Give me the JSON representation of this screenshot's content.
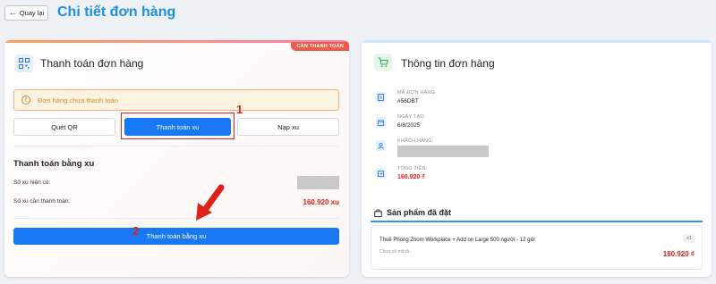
{
  "header": {
    "back_label": "Quay lại",
    "title": "Chi tiết đơn hàng"
  },
  "payment": {
    "badge": "CẦN THANH TOÁN",
    "title": "Thanh toán đơn hàng",
    "alert": "Đơn hàng chưa thanh toán",
    "tabs": [
      {
        "label": "Quét QR",
        "active": false
      },
      {
        "label": "Thanh toán xu",
        "active": true
      },
      {
        "label": "Nạp xu",
        "active": false
      }
    ],
    "section_title": "Thanh toán bằng xu",
    "balance_label": "Số xu hiện có:",
    "required_label": "Số xu cần thanh toán:",
    "required_value": "160.920 xu",
    "pay_button": "Thanh toán bằng xu"
  },
  "annotations": {
    "marker_1": "1",
    "marker_2": "2",
    "color": "#e0201a"
  },
  "order_info": {
    "title": "Thông tin đơn hàng",
    "order_code_label": "MÃ ĐƠN HÀNG:",
    "order_code": "#56DBT",
    "created_label": "NGÀY TẠO:",
    "created": "6/8/2025",
    "customer_label": "KHÁCH HÀNG:",
    "total_label": "TỔNG TIỀN:",
    "total": "160.920 ₫"
  },
  "products": {
    "title": "Sản phẩm đã đặt",
    "items": [
      {
        "name": "Thuê Phòng Zoom Workplace + Add on Large 500 người - 12 giờ",
        "description": "Chưa có mô tả",
        "quantity": "x1",
        "price": "160.920 ₫"
      }
    ]
  },
  "colors": {
    "primary": "#1877f2",
    "title_blue": "#1a8fe0",
    "danger": "#e0201a",
    "warning": "#e08a1e",
    "success": "#2bb24c"
  },
  "icons": {
    "back": "arrow-left-icon",
    "payment": "qr-code-icon",
    "alert": "clock-icon",
    "order": "cart-icon",
    "order_code": "document-icon",
    "date": "calendar-icon",
    "customer": "user-icon",
    "total": "receipt-icon",
    "products": "bag-icon"
  }
}
